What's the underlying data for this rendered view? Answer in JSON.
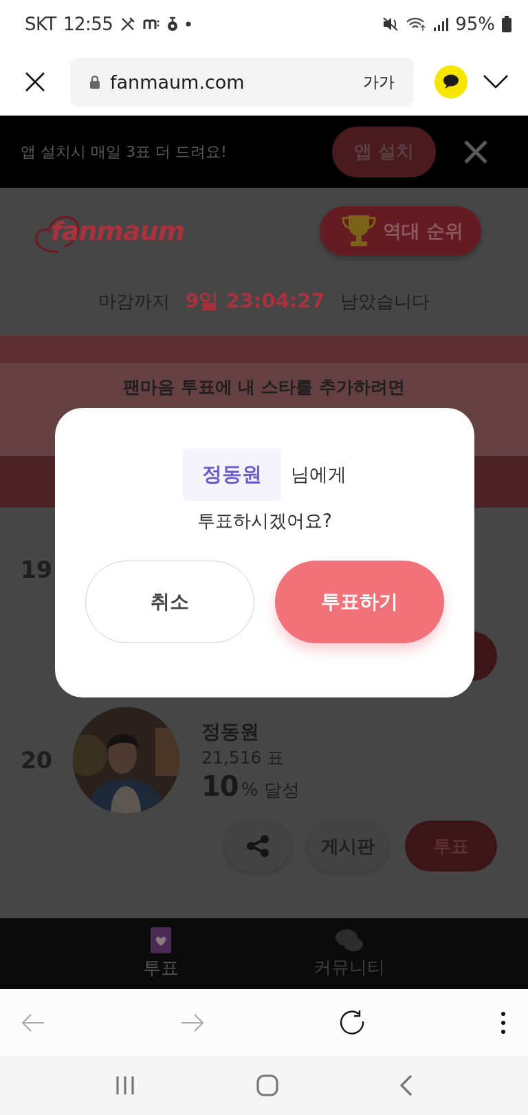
{
  "status_bar": {
    "carrier": "SKT",
    "time": "12:55",
    "battery": "95%"
  },
  "browser": {
    "url": "fanmaum.com",
    "text_size": "가가"
  },
  "app_banner": {
    "message": "앱 설치시 매일 3표 더 드려요!",
    "button": "앱 설치"
  },
  "header": {
    "logo": "fanmaum",
    "ranking_button": "역대 순위"
  },
  "deadline": {
    "prefix": "마감까지",
    "countdown": "9일 23:04:27",
    "suffix": "남았습니다"
  },
  "promo": {
    "text": "팬마음 투표에 내 스타를 추가하려면"
  },
  "ranking": [
    {
      "rank": "19"
    },
    {
      "rank": "20",
      "name": "정동원",
      "votes": "21,516 표",
      "percent": "10",
      "percent_suffix": "% 달성",
      "board_button": "게시판",
      "vote_button": "투표"
    }
  ],
  "dialog": {
    "name": "정동원",
    "name_suffix": "님에게",
    "question": "투표하시겠어요?",
    "buttons": [
      {
        "label": "취소",
        "kind": "cancel"
      },
      {
        "label": "투표하기",
        "kind": "confirm"
      }
    ]
  },
  "bottom_nav": [
    {
      "label": "투표",
      "selected": true
    },
    {
      "label": "커뮤니티",
      "selected": false
    }
  ]
}
